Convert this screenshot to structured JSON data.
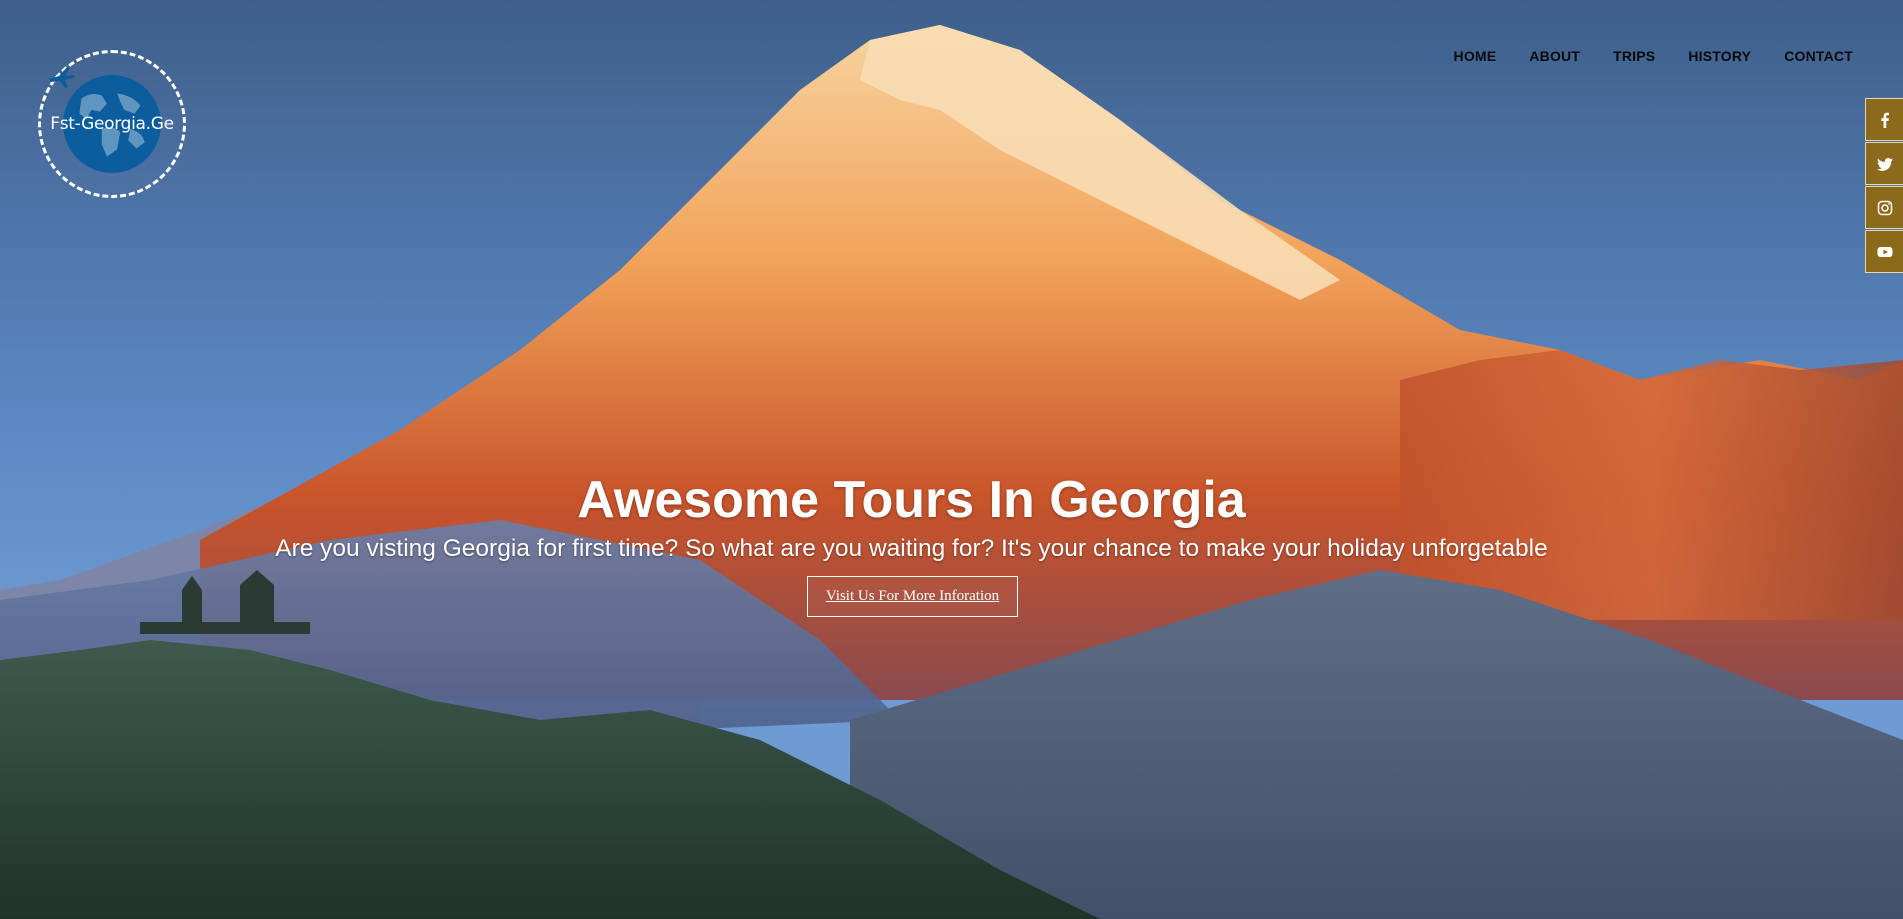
{
  "brand": {
    "logo_text": "Fst-Georgia.Ge"
  },
  "nav": {
    "items": [
      {
        "label": "HOME"
      },
      {
        "label": "ABOUT"
      },
      {
        "label": "TRIPS"
      },
      {
        "label": "HISTORY"
      },
      {
        "label": "CONTACT"
      }
    ]
  },
  "social": [
    {
      "icon": "facebook-icon"
    },
    {
      "icon": "twitter-icon"
    },
    {
      "icon": "instagram-icon"
    },
    {
      "icon": "youtube-icon"
    }
  ],
  "hero": {
    "title": "Awesome Tours In Georgia",
    "subtitle": "Are you visting Georgia for first time? So what are you waiting for? It's your chance to make your holiday unforgetable",
    "cta_label": "Visit Us For More Inforation"
  },
  "colors": {
    "social_bg": "#8b6a1c",
    "text": "#ffffff",
    "nav_text": "#0a0a0a",
    "logo_globe": "#0b5d9e"
  }
}
